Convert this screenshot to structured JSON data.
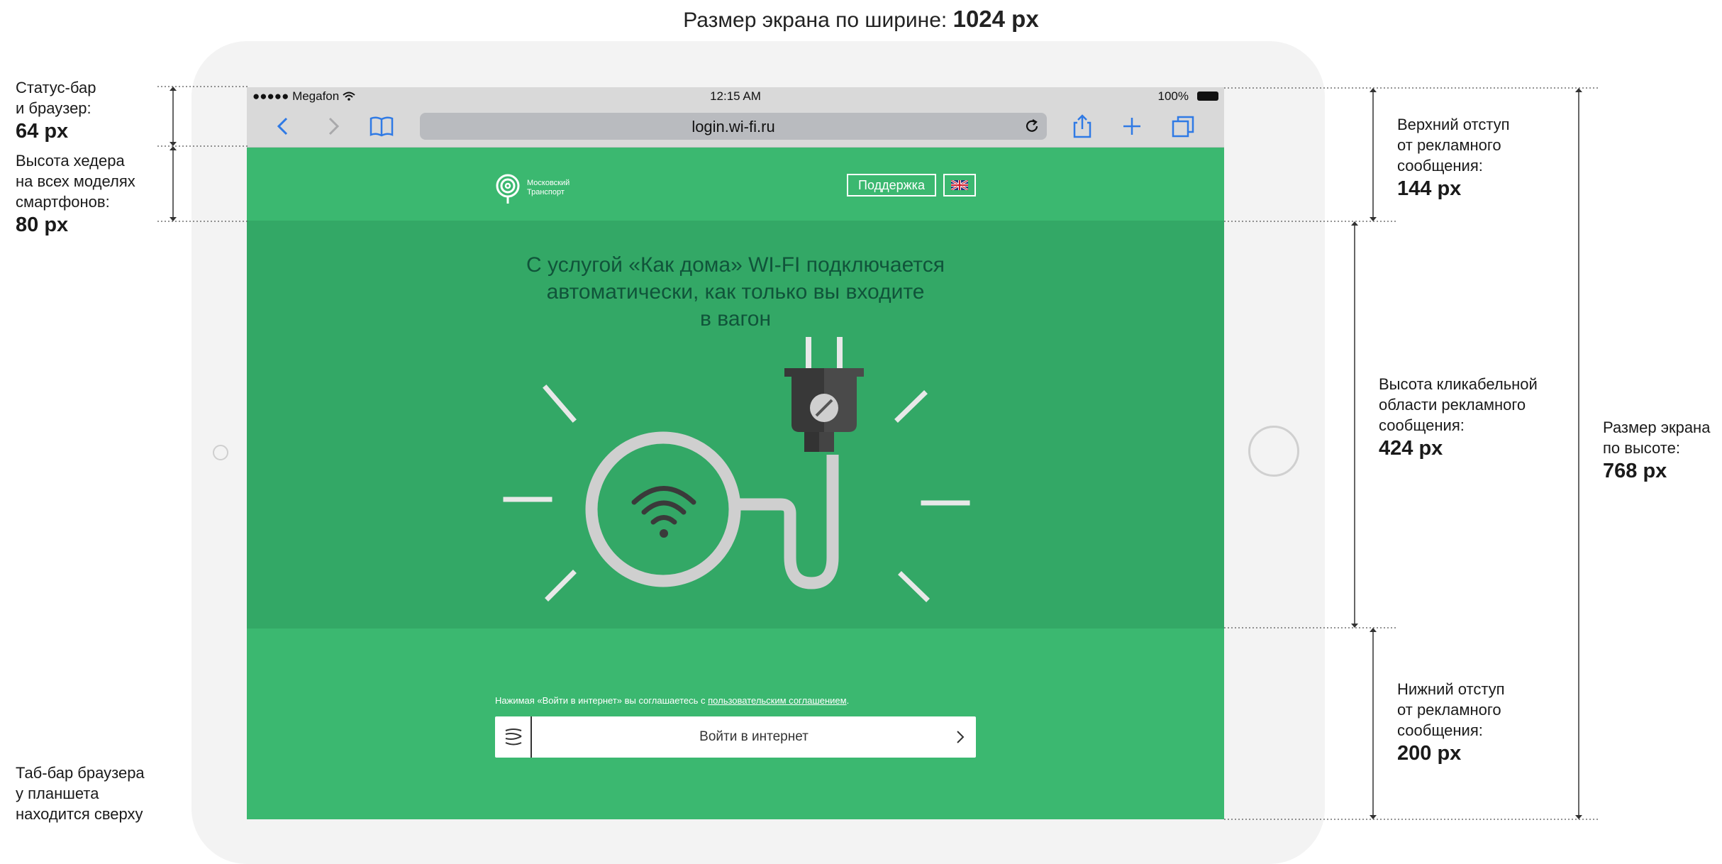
{
  "caption": {
    "text": "Размер экрана по ширине:",
    "value": "1024 px"
  },
  "status_bar": {
    "carrier": "●●●●● Megafon",
    "time": "12:15 AM",
    "battery": "100%"
  },
  "browser": {
    "url": "login.wi-fi.ru"
  },
  "header": {
    "logo_line1": "Московский",
    "logo_line2": "Транспорт",
    "support_label": "Поддержка"
  },
  "ad": {
    "headline_lines": [
      "С услугой «Как дома» WI-FI подключается",
      "автоматически, как только вы входите",
      "в вагон"
    ]
  },
  "footer": {
    "agree_prefix": "Нажимая «Войти в интернет» вы соглашаетесь с ",
    "agree_link": "пользовательским соглашением",
    "agree_suffix": ".",
    "login_label": "Войти в интернет"
  },
  "annotations": {
    "status": {
      "lines": [
        "Статус-бар",
        "и браузер:"
      ],
      "value": "64 px"
    },
    "header": {
      "lines": [
        "Высота хедера",
        "на всех моделях",
        "смартфонов:"
      ],
      "value": "80 px"
    },
    "tabbar": {
      "lines": [
        "Таб-бар браузера",
        "у планшета",
        "находится сверху"
      ]
    },
    "top_offset": {
      "lines": [
        "Верхний отступ",
        "от рекламного",
        "сообщения:"
      ],
      "value": "144 px"
    },
    "clickable": {
      "lines": [
        "Высота кликабельной",
        "области рекламного",
        "сообщения:"
      ],
      "value": "424 px"
    },
    "bottom_offset": {
      "lines": [
        "Нижний отступ",
        "от рекламного",
        "сообщения:"
      ],
      "value": "200 px"
    },
    "screen_height": {
      "lines": [
        "Размер экрана",
        "по высоте:"
      ],
      "value": "768 px"
    }
  },
  "colors": {
    "brand_green": "#3bb870",
    "ad_green": "#33a866",
    "headline": "#10543a"
  },
  "icons": [
    "wifi-status-icon",
    "back-icon",
    "forward-icon",
    "bookmarks-icon",
    "reload-icon",
    "share-icon",
    "new-tab-icon",
    "tabs-icon",
    "logo-icon",
    "uk-flag-icon",
    "plug-icon",
    "wifi-icon",
    "login-logo-icon",
    "chevron-right-icon"
  ]
}
